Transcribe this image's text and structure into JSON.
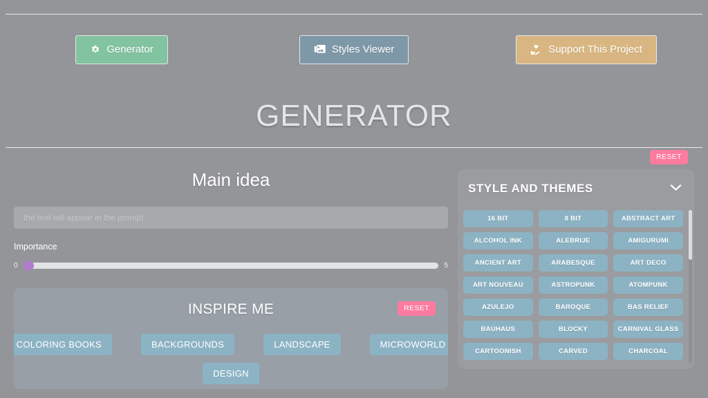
{
  "nav": {
    "buttons": [
      {
        "label": "Generator",
        "icon": "gear-icon",
        "color": "#82c3a0"
      },
      {
        "label": "Styles Viewer",
        "icon": "images-icon",
        "color": "#7e98a8"
      },
      {
        "label": "Support This Project",
        "icon": "hand-holding-heart-icon",
        "color": "#d9b681"
      }
    ]
  },
  "header": {
    "title": "GENERATOR"
  },
  "main_idea": {
    "heading": "Main idea",
    "input_value": "",
    "input_placeholder": "the text will appear in the prompt",
    "slider": {
      "label": "Importance",
      "min": "0",
      "max": "5",
      "value": 0
    }
  },
  "inspire": {
    "title": "INSPIRE ME",
    "reset_label": "RESET",
    "rows": [
      [
        "COLORING BOOKS",
        "BACKGROUNDS",
        "LANDSCAPE",
        "MICROWORLD"
      ],
      [
        "DESIGN"
      ]
    ]
  },
  "themes": {
    "reset_label": "RESET",
    "title": "STYLE AND THEMES",
    "chevron": "chevron-down-icon",
    "chips": [
      "16 BIT",
      "8 BIT",
      "ABSTRACT ART",
      "ALCOHOL INK",
      "ALEBRIJE",
      "AMIGURUMI",
      "ANCIENT ART",
      "ARABESQUE",
      "ART DECO",
      "ART NOUVEAU",
      "ASTROPUNK",
      "ATOMPUNK",
      "AZULEJO",
      "BAROQUE",
      "BAS RELIEF",
      "BAUHAUS",
      "BLOCKY",
      "CARNIVAL GLASS",
      "CARTOONISH",
      "CARVED",
      "CHARCOAL"
    ]
  },
  "colors": {
    "page_bg": "#939598",
    "green": "#82c3a0",
    "blue": "#7e98a8",
    "tan": "#d9b681",
    "pink": "#fc7b9e",
    "chip_blue": "#8cb3c4",
    "slider_thumb": "#b07ccc"
  }
}
